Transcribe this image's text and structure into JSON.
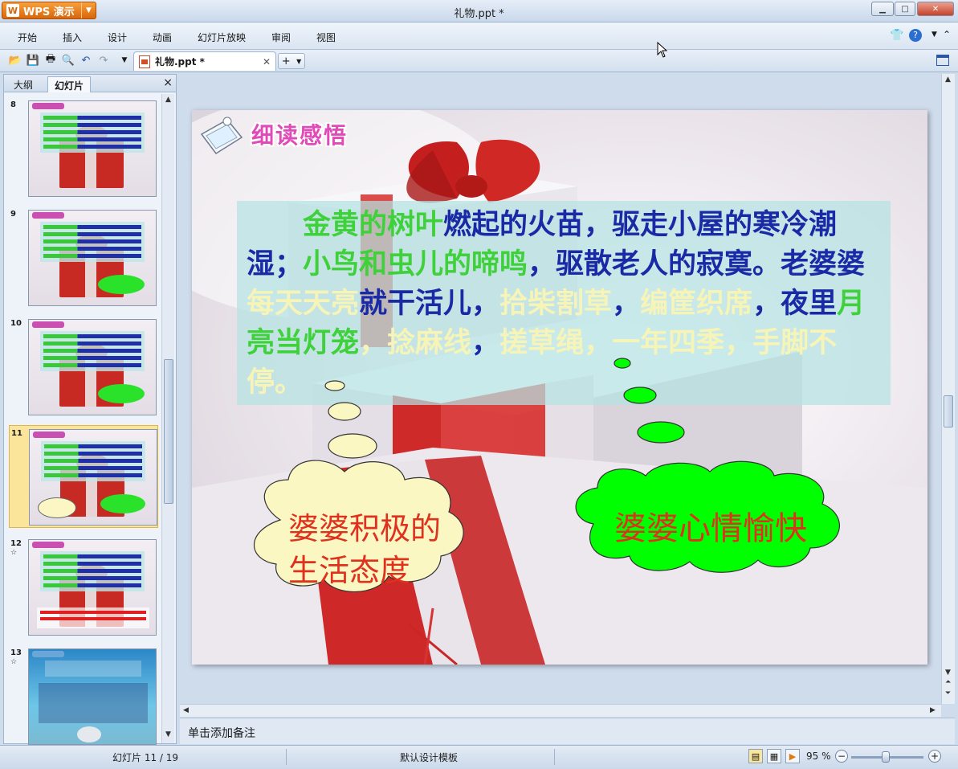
{
  "app": {
    "name": "WPS 演示",
    "window_title": "礼物.ppt *"
  },
  "menu": [
    "开始",
    "插入",
    "设计",
    "动画",
    "幻灯片放映",
    "审阅",
    "视图"
  ],
  "toolbar": {
    "doc_tab": "礼物.ppt *",
    "new_tab_plus": "+"
  },
  "panel": {
    "tab_outline": "大纲",
    "tab_slides": "幻灯片",
    "close": "×"
  },
  "thumbnails": [
    {
      "num": "8",
      "star": ""
    },
    {
      "num": "9",
      "star": ""
    },
    {
      "num": "10",
      "star": ""
    },
    {
      "num": "11",
      "star": ""
    },
    {
      "num": "12",
      "star": "☆"
    },
    {
      "num": "13",
      "star": "☆"
    }
  ],
  "slide": {
    "header": "细读感悟",
    "para": {
      "indent": "　　",
      "s1": "金黄的树叶",
      "s2": "燃起的火苗，驱走小屋的寒冷潮湿；",
      "s3": "小鸟和虫儿的啼鸣",
      "s4": "，驱散老人的寂寞。老婆婆",
      "s5": "每天天亮",
      "s6": "就干活儿，",
      "s7": "拾柴割草",
      "s8": "，",
      "s9": "编筐织席",
      "s10": "，夜里",
      "s11": "月亮当灯笼",
      "s12": "，",
      "s13": "捻麻线",
      "s14": "，",
      "s15": "搓草绳",
      "s16": "，",
      "s17": "一年四季",
      "s18": "，手脚不停。"
    },
    "cloud_left_line1": "婆婆积极的",
    "cloud_left_line2": "生活态度",
    "cloud_right": "婆婆心情愉快"
  },
  "notes_placeholder": "单击添加备注",
  "status": {
    "slide_counter": "幻灯片 11 / 19",
    "template": "默认设计模板",
    "zoom": "95 %"
  },
  "colors": {
    "green": "#3ed13a",
    "navy": "#1a2aa6",
    "cream": "#f7f4b8",
    "accent_red": "#e0301e",
    "cloud_green": "#00ff00"
  }
}
